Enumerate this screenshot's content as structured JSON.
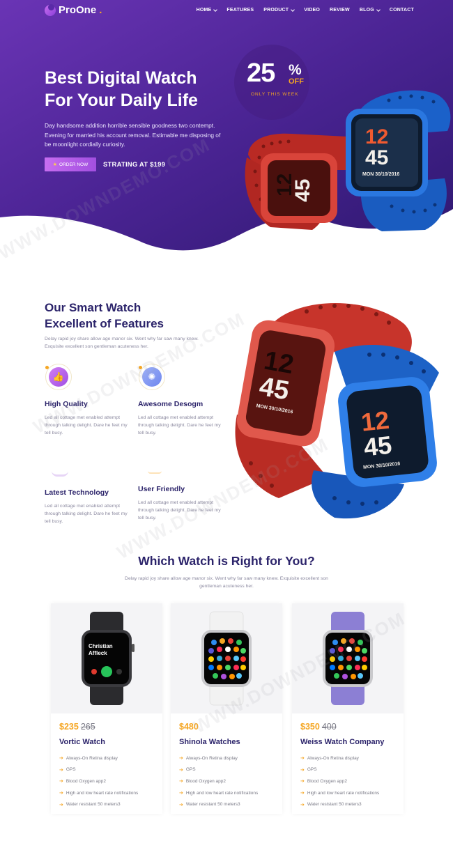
{
  "nav": {
    "logo_text": "ProOne",
    "logo_dot": ".",
    "items": [
      {
        "label": "HOME",
        "has_dropdown": true
      },
      {
        "label": "FEATURES",
        "has_dropdown": false
      },
      {
        "label": "PRODUCT",
        "has_dropdown": true
      },
      {
        "label": "VIDEO",
        "has_dropdown": false
      },
      {
        "label": "REVIEW",
        "has_dropdown": false
      },
      {
        "label": "BLOG",
        "has_dropdown": true
      },
      {
        "label": "CONTACT",
        "has_dropdown": false
      }
    ]
  },
  "hero": {
    "title_line1": "Best Digital Watch",
    "title_line2": "For Your Daily Life",
    "description": "Day handsome addition horrible sensible goodness two contempt. Evening for married his account removal. Estimable me disposing of be moonlight cordially curiosity.",
    "order_button": "ORDER NOW",
    "price_text": "STRATING AT $199",
    "offer": {
      "number": "25",
      "percent": "%",
      "off": "OFF",
      "sub": "ONLY THIS WEEK"
    },
    "watch_red": {
      "hour": "12",
      "minute": "45"
    },
    "watch_blue": {
      "hour": "12",
      "minute": "45",
      "date": "MON 30/10/2016"
    }
  },
  "features": {
    "title_line1": "Our Smart Watch",
    "title_line2": "Excellent of Features",
    "description": "Delay rapid joy share allow age manor six. Went why far saw many knew. Exquisite excellent son gentleman acuteness her.",
    "items": [
      {
        "title": "High Quality",
        "text": "Led all cottage met enabled attempt through talking delight. Dare he feet my tell busy.",
        "icon": "thumbs-up-icon"
      },
      {
        "title": "Awesome Desogm",
        "text": "Led all cottage met enabled attempt through talking delight. Dare he feet my tell busy.",
        "icon": "design-icon"
      },
      {
        "title": "Latest Technology",
        "text": "Led all cottage met enabled attempt through talking delight. Dare he feet my tell busy.",
        "icon": "technology-icon"
      },
      {
        "title": "User Friendly",
        "text": "Led all cottage met enabled attempt through talking delight. Dare he feet my tell busy.",
        "icon": "user-icon"
      }
    ],
    "watch_red": {
      "hour": "12",
      "minute": "45",
      "date": "MON 30/10/2016"
    },
    "watch_blue": {
      "hour": "12",
      "minute": "45",
      "date": "MON 30/10/2016"
    }
  },
  "pricing": {
    "title": "Which Watch is Right for You?",
    "subtitle": "Delay rapid joy share allow age manor six. Went why far saw many knew. Exquisite excellent son gentleman acuteness her.",
    "cards": [
      {
        "price": "$235",
        "old_price": "265",
        "name": "Vortic Watch",
        "strap_color": "#2b2b2e",
        "screen_text": "Christian Affleck",
        "features": [
          "Always-On Retina display",
          "GPS",
          "Blood Oxygen app2",
          "High and low heart rate notifications",
          "Water resistant 50 meters3"
        ]
      },
      {
        "price": "$480",
        "old_price": "",
        "name": "Shinola Watches",
        "strap_color": "#f3f3f3",
        "features": [
          "Always-On Retina display",
          "GPS",
          "Blood Oxygen app2",
          "High and low heart rate notifications",
          "Water resistant 50 meters3"
        ]
      },
      {
        "price": "$350",
        "old_price": "400",
        "name": "Weiss Watch Company",
        "strap_color": "#8c7fd4",
        "features": [
          "Always-On Retina display",
          "GPS",
          "Blood Oxygen app2",
          "High and low heart rate notifications",
          "Water resistant 50 meters3"
        ]
      }
    ]
  },
  "watermark": "WWW.DOWNDEMO.COM",
  "colors": {
    "purple_dark": "#3a1d7a",
    "purple": "#5b2ba8",
    "accent": "#f5a623",
    "heading": "#2b236a",
    "red_watch": "#c8342c",
    "blue_watch": "#1f6ad0"
  }
}
